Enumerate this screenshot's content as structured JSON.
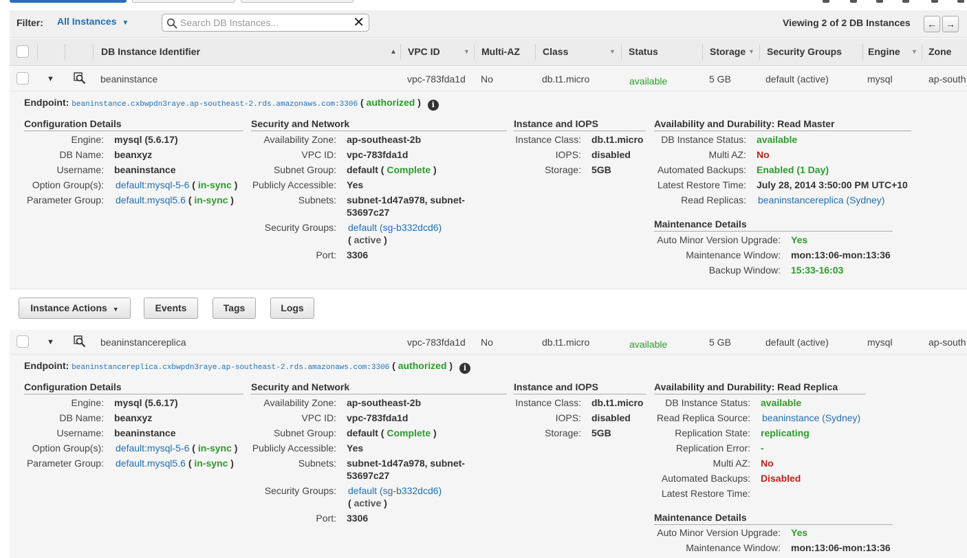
{
  "filter": {
    "label": "Filter:",
    "selected": "All Instances",
    "search_placeholder": "Search DB Instances...",
    "viewing": "Viewing 2 of 2 DB Instances"
  },
  "columns": [
    "DB Instance Identifier",
    "VPC ID",
    "Multi-AZ",
    "Class",
    "Status",
    "Storage",
    "Security Groups",
    "Engine",
    "Zone"
  ],
  "action_buttons": {
    "instance_actions": "Instance Actions",
    "events": "Events",
    "tags": "Tags",
    "logs": "Logs"
  },
  "colors": {
    "link": "#1f6fb5",
    "green": "#2a9d2a",
    "red": "#c0211a"
  },
  "common_labels": {
    "endpoint": "Endpoint:",
    "authorized": "authorized",
    "config_title": "Configuration Details",
    "security_title": "Security and Network",
    "iops_title": "Instance and IOPS",
    "maint_title": "Maintenance Details",
    "engine": "Engine:",
    "db_name": "DB Name:",
    "username": "Username:",
    "option_group": "Option Group(s):",
    "parameter_group": "Parameter Group:",
    "availability_zone": "Availability Zone:",
    "vpc_id": "VPC ID:",
    "subnet_group": "Subnet Group:",
    "publicly_accessible": "Publicly Accessible:",
    "subnets": "Subnets:",
    "security_groups": "Security Groups:",
    "port": "Port:",
    "instance_class": "Instance Class:",
    "iops": "IOPS:",
    "storage": "Storage:",
    "db_instance_status": "DB Instance Status:",
    "multi_az": "Multi AZ:",
    "automated_backups": "Automated Backups:",
    "latest_restore": "Latest Restore Time:",
    "read_replicas": "Read Replicas:",
    "read_replica_source": "Read Replica Source:",
    "replication_state": "Replication State:",
    "replication_error": "Replication Error:",
    "auto_minor": "Auto Minor Version Upgrade:",
    "maint_window": "Maintenance Window:",
    "backup_window": "Backup Window:"
  },
  "instances": [
    {
      "id": "beaninstance",
      "vpc": "vpc-783fda1d",
      "multi_az": "No",
      "class": "db.t1.micro",
      "status": "available",
      "storage": "5 GB",
      "security_groups": "default (active)",
      "engine": "mysql",
      "zone": "ap-south",
      "endpoint": "beaninstance.cxbwpdn3raye.ap-southeast-2.rds.amazonaws.com:3306",
      "availability_title": "Availability and Durability: Read Master",
      "config": {
        "engine": "mysql (5.6.17)",
        "db_name": "beanxyz",
        "username": "beaninstance",
        "option_group": "default:mysql-5-6",
        "option_status": "in-sync",
        "parameter_group": "default.mysql5.6",
        "parameter_status": "in-sync"
      },
      "security": {
        "az": "ap-southeast-2b",
        "vpc_id": "vpc-783fda1d",
        "subnet_group": "default",
        "subnet_group_status": "Complete",
        "public": "Yes",
        "subnets_1": "subnet-1d47a978, subnet-",
        "subnets_2": "53697c27",
        "sg": "default (sg-b332dcd6)",
        "sg_status": "active",
        "port": "3306"
      },
      "iops": {
        "class": "db.t1.micro",
        "iops": "disabled",
        "storage": "5GB"
      },
      "avail": {
        "status": "available",
        "multi_az": "No",
        "backups": "Enabled (1 Day)",
        "restore": "July 28, 2014 3:50:00 PM UTC+10",
        "replicas": "beaninstancereplica (Sydney)"
      },
      "maint": {
        "auto_minor": "Yes",
        "window": "mon:13:06-mon:13:36",
        "backup_window": "15:33-16:03"
      }
    },
    {
      "id": "beaninstancereplica",
      "vpc": "vpc-783fda1d",
      "multi_az": "No",
      "class": "db.t1.micro",
      "status": "available",
      "storage": "5 GB",
      "security_groups": "default (active)",
      "engine": "mysql",
      "zone": "ap-south",
      "endpoint": "beaninstancereplica.cxbwpdn3raye.ap-southeast-2.rds.amazonaws.com:3306",
      "availability_title": "Availability and Durability: Read Replica",
      "config": {
        "engine": "mysql (5.6.17)",
        "db_name": "beanxyz",
        "username": "beaninstance",
        "option_group": "default:mysql-5-6",
        "option_status": "in-sync",
        "parameter_group": "default.mysql5.6",
        "parameter_status": "in-sync"
      },
      "security": {
        "az": "ap-southeast-2b",
        "vpc_id": "vpc-783fda1d",
        "subnet_group": "default",
        "subnet_group_status": "Complete",
        "public": "Yes",
        "subnets_1": "subnet-1d47a978, subnet-",
        "subnets_2": "53697c27",
        "sg": "default (sg-b332dcd6)",
        "sg_status": "active",
        "port": "3306"
      },
      "iops": {
        "class": "db.t1.micro",
        "iops": "disabled",
        "storage": "5GB"
      },
      "avail": {
        "status": "available",
        "source": "beaninstance (Sydney)",
        "replication_state": "replicating",
        "replication_error": "-",
        "multi_az": "No",
        "backups": "Disabled",
        "restore": ""
      },
      "maint": {
        "auto_minor": "Yes",
        "window": "mon:13:06-mon:13:36"
      }
    }
  ]
}
